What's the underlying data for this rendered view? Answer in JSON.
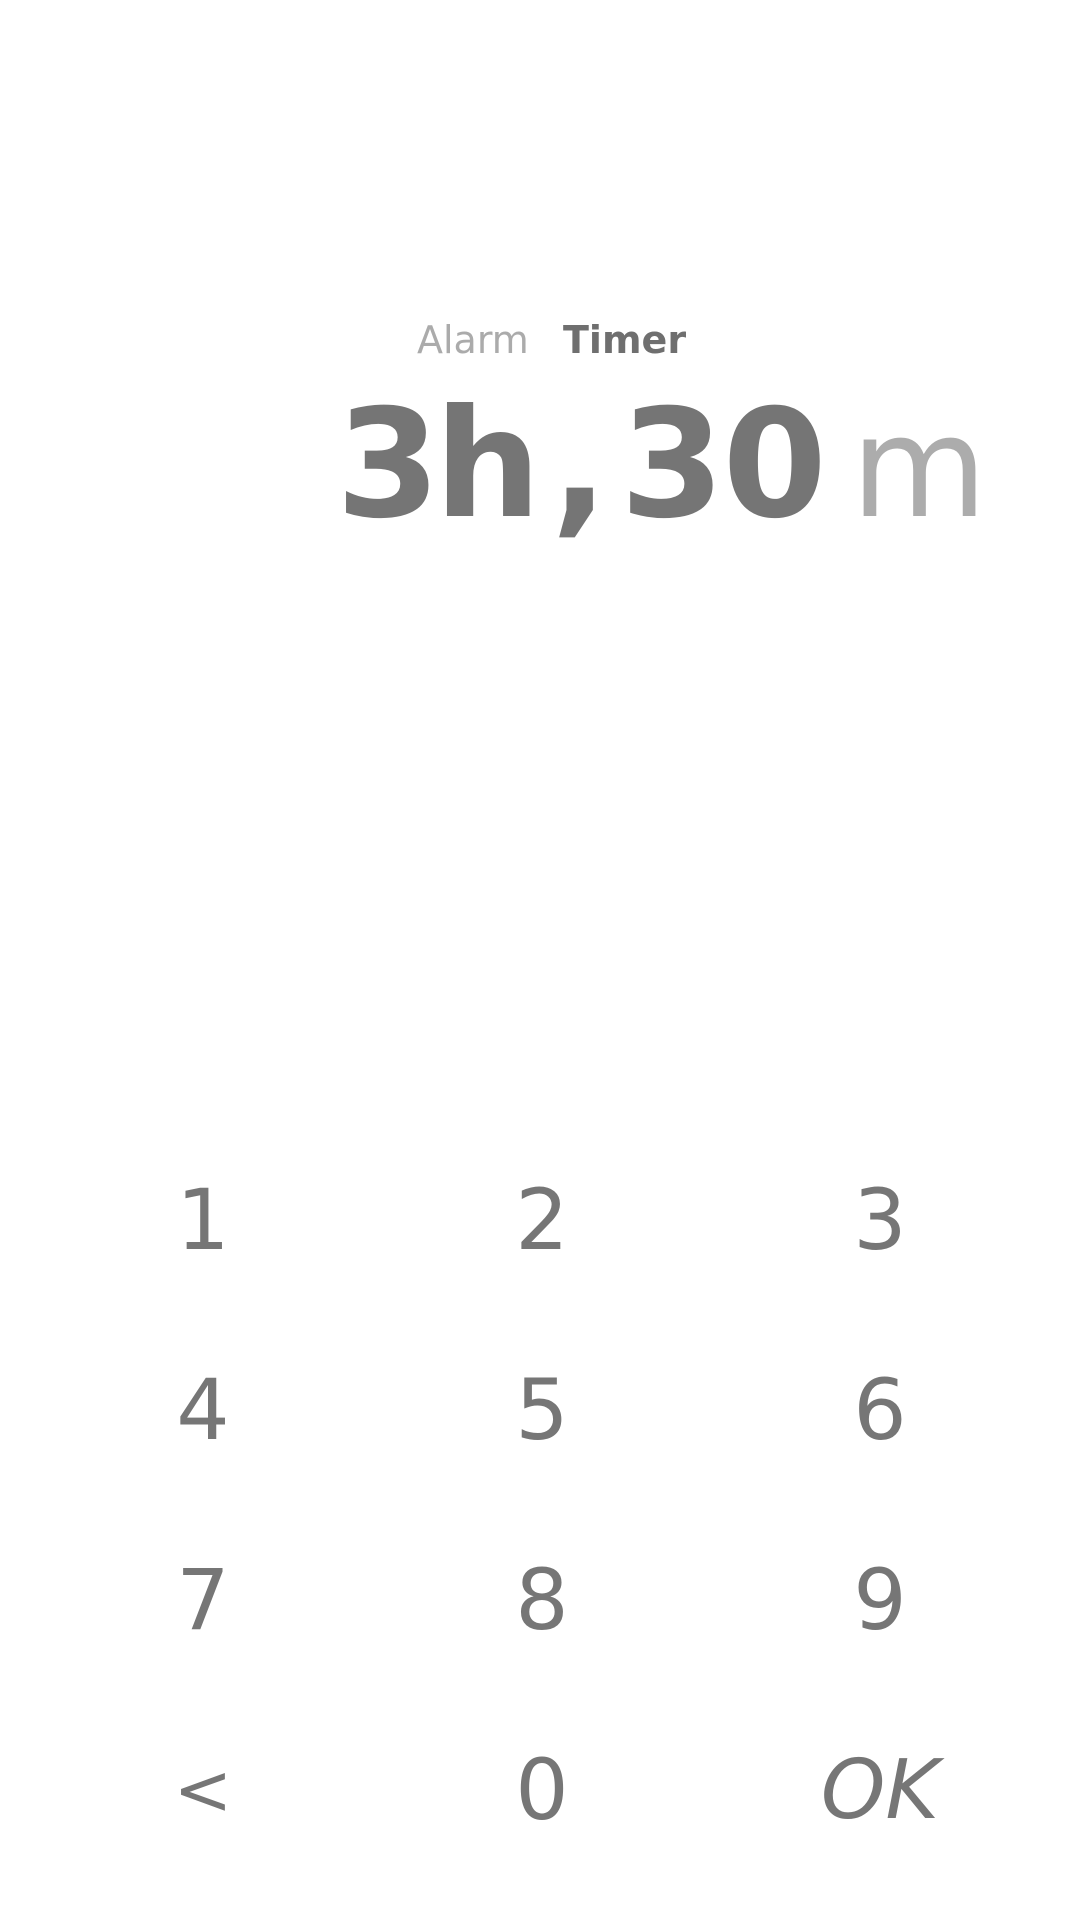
{
  "mode_tabs": {
    "alarm": "Alarm",
    "timer": "Timer",
    "selected": "Timer"
  },
  "time_display": {
    "hours": "3",
    "hours_unit": "h",
    "separator": ",",
    "minutes": "30",
    "minutes_unit": "m"
  },
  "keypad": {
    "k1": "1",
    "k2": "2",
    "k3": "3",
    "k4": "4",
    "k5": "5",
    "k6": "6",
    "k7": "7",
    "k8": "8",
    "k9": "9",
    "back": "<",
    "k0": "0",
    "ok": "OK"
  },
  "colors": {
    "background": "#ffffff",
    "text_primary": "#757575",
    "text_dim": "#acacac"
  }
}
